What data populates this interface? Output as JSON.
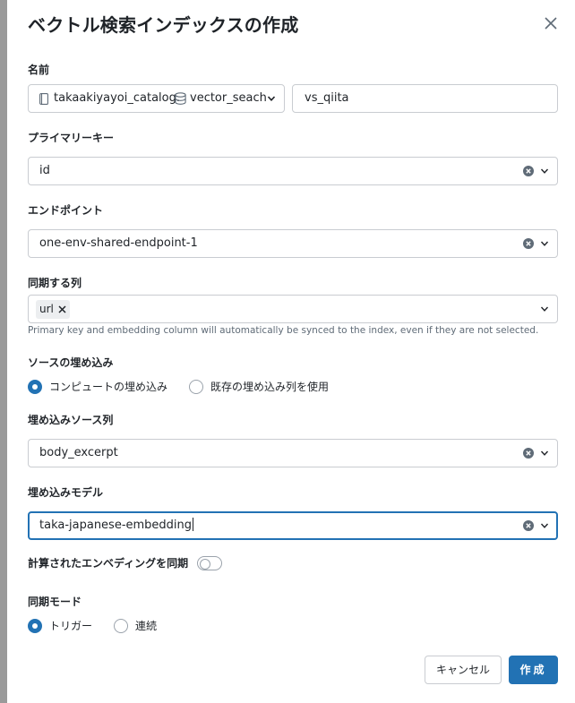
{
  "dialog": {
    "title": "ベクトル検索インデックスの作成"
  },
  "name": {
    "label": "名前",
    "catalog": "takaakiyayoi_catalog",
    "separator": ".",
    "schema": "vector_seach",
    "index_name": "vs_qiita"
  },
  "primary_key": {
    "label": "プライマリーキー",
    "value": "id"
  },
  "endpoint": {
    "label": "エンドポイント",
    "value": "one-env-shared-endpoint-1"
  },
  "sync_columns": {
    "label": "同期する列",
    "tags": [
      "url"
    ],
    "help": "Primary key and embedding column will automatically be synced to the index, even if they are not selected."
  },
  "embedding_source": {
    "label": "ソースの埋め込み",
    "options": [
      "コンピュートの埋め込み",
      "既存の埋め込み列を使用"
    ],
    "selected": "コンピュートの埋め込み"
  },
  "embedding_source_column": {
    "label": "埋め込みソース列",
    "value": "body_excerpt"
  },
  "embedding_model": {
    "label": "埋め込みモデル",
    "value": "taka-japanese-embedding"
  },
  "sync_computed": {
    "label": "計算されたエンベディングを同期",
    "enabled": false
  },
  "sync_mode": {
    "label": "同期モード",
    "options": [
      "トリガー",
      "連続"
    ],
    "selected": "トリガー"
  },
  "buttons": {
    "cancel": "キャンセル",
    "create": "作成"
  },
  "colors": {
    "primary": "#2272b4",
    "border": "#c9ccd1",
    "help_text": "#5f6b77"
  }
}
